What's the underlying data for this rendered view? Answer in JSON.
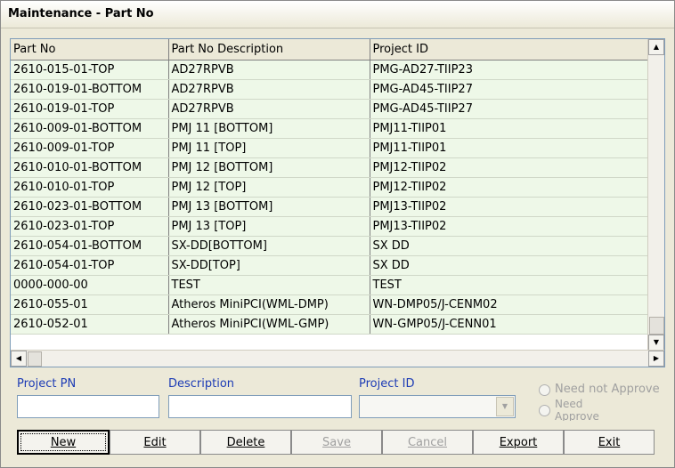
{
  "window": {
    "title": "Maintenance - Part No"
  },
  "grid": {
    "columns": [
      "Part No",
      "Part No Description",
      "Project ID"
    ],
    "rows": [
      [
        "2610-015-01-TOP",
        "AD27RPVB",
        "PMG-AD27-TIIP23"
      ],
      [
        "2610-019-01-BOTTOM",
        "AD27RPVB",
        "PMG-AD45-TIIP27"
      ],
      [
        "2610-019-01-TOP",
        "AD27RPVB",
        "PMG-AD45-TIIP27"
      ],
      [
        "2610-009-01-BOTTOM",
        "PMJ 11 [BOTTOM]",
        "PMJ11-TIIP01"
      ],
      [
        "2610-009-01-TOP",
        "PMJ 11 [TOP]",
        "PMJ11-TIIP01"
      ],
      [
        "2610-010-01-BOTTOM",
        "PMJ 12 [BOTTOM]",
        "PMJ12-TIIP02"
      ],
      [
        "2610-010-01-TOP",
        "PMJ 12 [TOP]",
        "PMJ12-TIIP02"
      ],
      [
        "2610-023-01-BOTTOM",
        "PMJ 13 [BOTTOM]",
        "PMJ13-TIIP02"
      ],
      [
        "2610-023-01-TOP",
        "PMJ 13 [TOP]",
        "PMJ13-TIIP02"
      ],
      [
        "2610-054-01-BOTTOM",
        "SX-DD[BOTTOM]",
        "SX DD"
      ],
      [
        "2610-054-01-TOP",
        "SX-DD[TOP]",
        "SX DD"
      ],
      [
        "0000-000-00",
        "TEST",
        "TEST"
      ],
      [
        "2610-055-01",
        "Atheros MiniPCI(WML-DMP)",
        "WN-DMP05/J-CENM02"
      ],
      [
        "2610-052-01",
        "Atheros MiniPCI(WML-GMP)",
        "WN-GMP05/J-CENN01"
      ]
    ]
  },
  "form": {
    "project_pn_label": "Project PN",
    "project_pn_value": "",
    "description_label": "Description",
    "description_value": "",
    "project_id_label": "Project ID",
    "project_id_value": "",
    "radio_need_not_approve": "Need not Approve",
    "radio_need_approve": "Need Approve"
  },
  "buttons": {
    "new": "New",
    "edit": "Edit",
    "delete": "Delete",
    "save": "Save",
    "cancel": "Cancel",
    "export": "Export",
    "exit": "Exit"
  },
  "icons": {
    "scroll_up": "scroll-up-icon",
    "scroll_down": "scroll-down-icon",
    "scroll_left": "scroll-left-icon",
    "scroll_right": "scroll-right-icon",
    "combo": "chevron-down-icon"
  }
}
